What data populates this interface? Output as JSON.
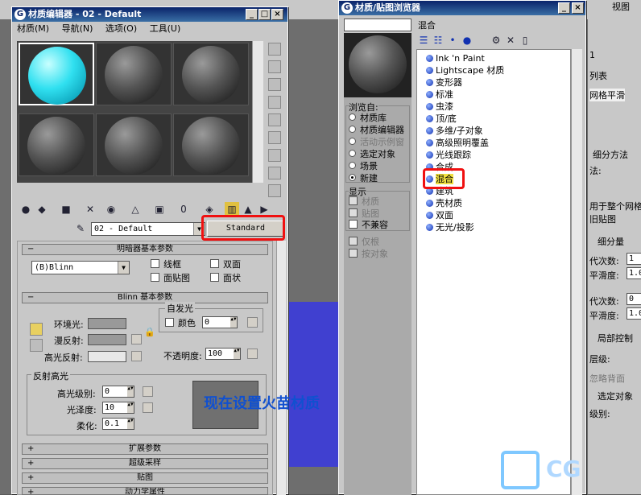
{
  "mat_editor": {
    "title": "材质编辑器 - 02 - Default",
    "menu": [
      "材质(M)",
      "导航(N)",
      "选项(O)",
      "工具(U)"
    ],
    "material_name": "02 - Default",
    "type_button": "Standard",
    "shader_section": "明暗器基本参数",
    "shader_type": "(B)Blinn",
    "checks": {
      "wire": "线框",
      "two_sided": "双面",
      "face_map": "面贴图",
      "faceted": "面状"
    },
    "blinn_section": "Blinn 基本参数",
    "self_illum": "自发光",
    "color_label": "颜色",
    "color_value": "0",
    "ambient": "环境光:",
    "diffuse": "漫反射:",
    "specular": "高光反射:",
    "opacity_label": "不透明度:",
    "opacity_value": "100",
    "spec_highlights": "反射高光",
    "spec_level_label": "高光级别:",
    "spec_level_value": "0",
    "gloss_label": "光泽度:",
    "gloss_value": "10",
    "soften_label": "柔化:",
    "soften_value": "0.1",
    "rollouts": [
      "扩展参数",
      "超级采样",
      "贴图",
      "动力学属性"
    ],
    "annotation": "现在设置火苗材质"
  },
  "browser": {
    "title": "材质/贴图浏览器",
    "name_value": "混合",
    "browse_from_label": "浏览自:",
    "browse_from": [
      "材质库",
      "材质编辑器",
      "活动示例窗",
      "选定对象",
      "场景",
      "新建"
    ],
    "show_label": "显示",
    "show": [
      "材质",
      "贴图",
      "不兼容"
    ],
    "filter": [
      "仅根",
      "按对象"
    ],
    "materials": [
      "Ink 'n Paint",
      "Lightscape 材质",
      "变形器",
      "标准",
      "虫漆",
      "顶/底",
      "多维/子对象",
      "高级照明覆盖",
      "光线跟踪",
      "合成",
      "混合",
      "建筑",
      "壳材质",
      "双面",
      "无光/投影"
    ]
  },
  "right_panel": {
    "top_label": "视图",
    "number": "1",
    "list_label": "列表",
    "items": [
      "网格平滑",
      "细分方法",
      "法:",
      "用于整个网格",
      "旧贴图",
      "细分量",
      "代次数:",
      "平滑度:",
      "代次数:",
      "平滑度:",
      "局部控制",
      "层级:",
      "忽略背面",
      "选定对象",
      "级别:"
    ],
    "values": [
      "1",
      "1.0",
      "0",
      "1.0"
    ]
  },
  "watermark": "CG"
}
